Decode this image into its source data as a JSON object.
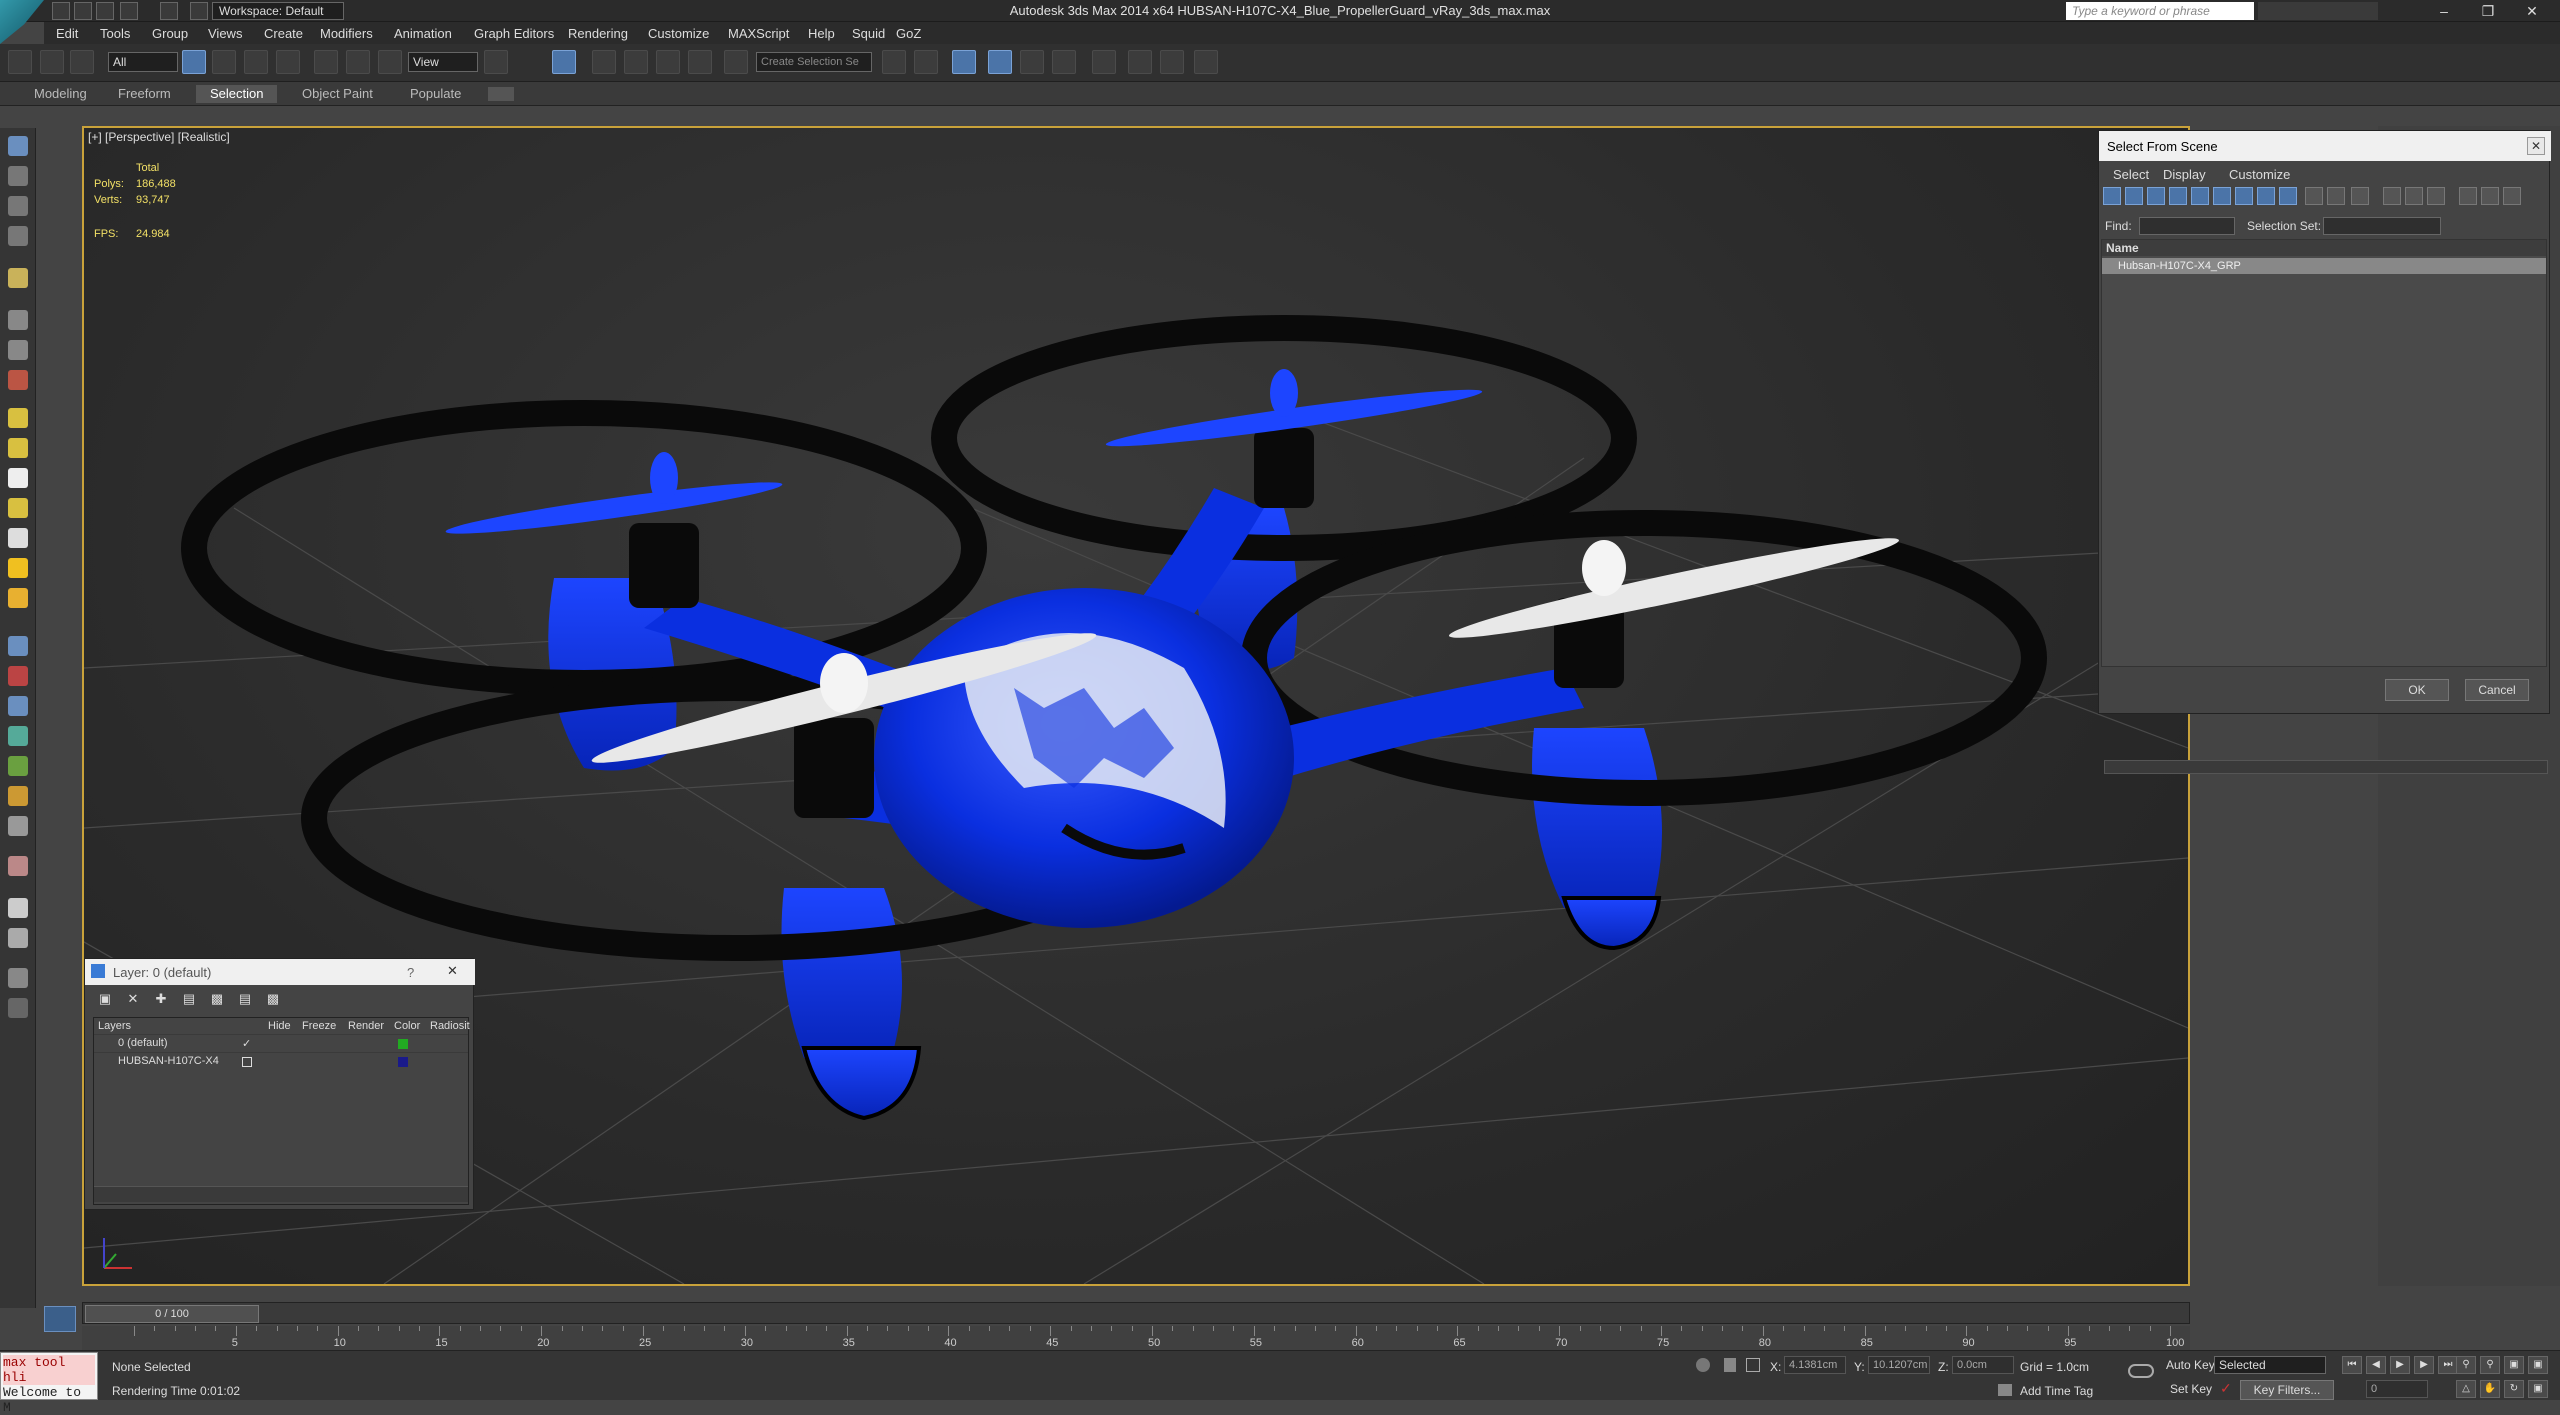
{
  "titlebar": {
    "title": "Autodesk 3ds Max  2014 x64     HUBSAN-H107C-X4_Blue_PropellerGuard_vRay_3ds_max.max",
    "workspace": "Workspace: Default",
    "search_placeholder": "Type a keyword or phrase"
  },
  "menu": [
    "Edit",
    "Tools",
    "Group",
    "Views",
    "Create",
    "Modifiers",
    "Animation",
    "Graph Editors",
    "Rendering",
    "Customize",
    "MAXScript",
    "Help",
    "Squid",
    "GoZ"
  ],
  "toolbar": {
    "selection_filter": "All",
    "reference_coord": "View",
    "named_selection_placeholder": "Create Selection Se"
  },
  "ribbon_tabs": [
    "Modeling",
    "Freeform",
    "Selection",
    "Object Paint",
    "Populate"
  ],
  "ribbon_active": "Selection",
  "viewport": {
    "label": "[+] [Perspective] [Realistic]",
    "stats": {
      "total_label": "Total",
      "polys_label": "Polys:",
      "polys": "186,488",
      "verts_label": "Verts:",
      "verts": "93,747",
      "fps_label": "FPS:",
      "fps": "24.984"
    }
  },
  "select_from_scene": {
    "title": "Select From Scene",
    "menu": [
      "Select",
      "Display",
      "Customize"
    ],
    "find_label": "Find:",
    "selection_set_label": "Selection Set:",
    "column_name": "Name",
    "items": [
      "Hubsan-H107C-X4_GRP"
    ],
    "ok": "OK",
    "cancel": "Cancel"
  },
  "layer_dialog": {
    "title": "Layer: 0 (default)",
    "help": "?",
    "columns": [
      "Layers",
      "Hide",
      "Freeze",
      "Render",
      "Color",
      "Radiosit"
    ],
    "rows": [
      {
        "name": "0 (default)",
        "color": "#22aa22"
      },
      {
        "name": "HUBSAN-H107C-X4",
        "color": "#1a1a8a"
      }
    ]
  },
  "timeline": {
    "slider": "0 / 100",
    "ticks": [
      "5",
      "10",
      "15",
      "20",
      "25",
      "30",
      "35",
      "40",
      "45",
      "50",
      "55",
      "60",
      "65",
      "70",
      "75",
      "80",
      "85",
      "90",
      "95",
      "100"
    ]
  },
  "status": {
    "maxscript_line1": "max tool hli",
    "maxscript_line2": "Welcome to M",
    "selection": "None Selected",
    "render_time": "Rendering Time  0:01:02",
    "x_label": "X:",
    "x_value": "4.1381cm",
    "y_label": "Y:",
    "y_value": "10.1207cm",
    "z_label": "Z:",
    "z_value": "0.0cm",
    "grid": "Grid = 1.0cm",
    "add_time_tag": "Add Time Tag",
    "auto_key": "Auto Key",
    "set_key": "Set Key",
    "key_mode": "Selected",
    "key_filters": "Key Filters...",
    "frame": "0"
  },
  "colors": {
    "drone_blue": "#0a2fe0",
    "guard_black": "#0a0a0a",
    "viewport_border": "#c9a23a",
    "stat_yellow": "#f2e066"
  }
}
